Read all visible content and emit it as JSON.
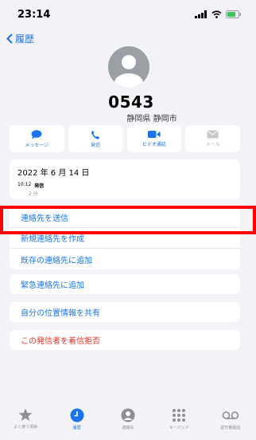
{
  "status_bar": {
    "time": "23:14"
  },
  "nav": {
    "back_label": "履歴"
  },
  "contact": {
    "number": "0543",
    "location": "静岡県 静岡市"
  },
  "actions": [
    {
      "label": "メッセージ",
      "icon": "message-icon"
    },
    {
      "label": "発信",
      "icon": "phone-icon"
    },
    {
      "label": "ビデオ通話",
      "icon": "video-icon"
    },
    {
      "label": "メール",
      "icon": "mail-icon"
    }
  ],
  "history": {
    "date": "2022 年 6 月 14 日",
    "time": "10:12",
    "direction": "発信",
    "duration": "2 分"
  },
  "menu": {
    "send_contact": "連絡先を送信",
    "new_contact": "新規連絡先を作成",
    "add_existing": "既存の連絡先に追加",
    "add_emergency": "緊急連絡先に追加",
    "share_location": "自分の位置情報を共有",
    "block_caller": "この発信者を着信拒否"
  },
  "tabs": [
    {
      "label": "よく使う項目",
      "icon": "star-icon"
    },
    {
      "label": "履歴",
      "icon": "clock-icon",
      "active": true
    },
    {
      "label": "連絡先",
      "icon": "contact-icon"
    },
    {
      "label": "キーパッド",
      "icon": "keypad-icon"
    },
    {
      "label": "留守番電話",
      "icon": "voicemail-icon"
    }
  ],
  "colors": {
    "accent": "#1a73e8",
    "danger": "#e0352b",
    "highlight": "#ff0000"
  }
}
